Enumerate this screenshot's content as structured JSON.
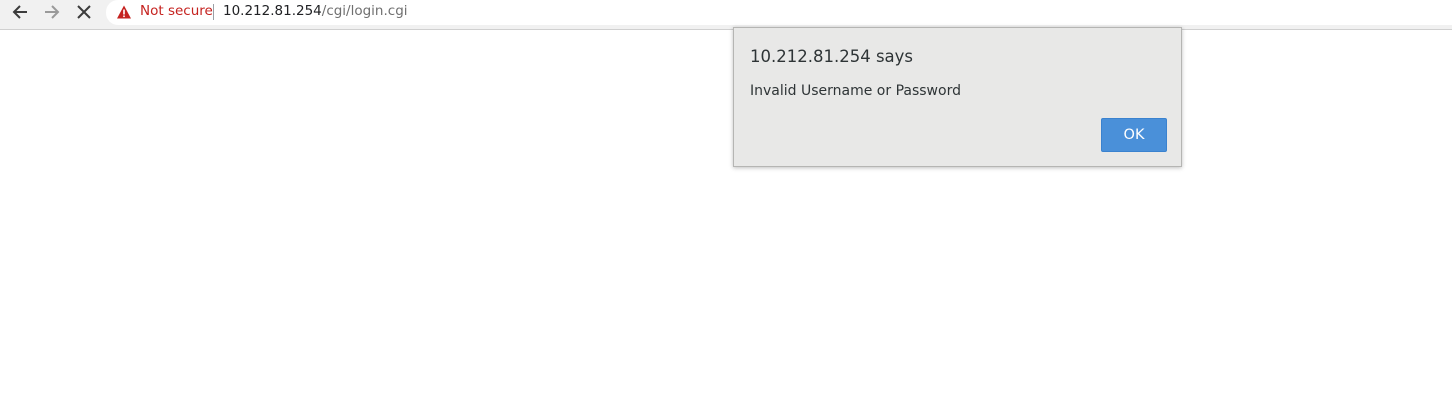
{
  "browser": {
    "nav": {
      "back_icon": "arrow-left-icon",
      "forward_icon": "arrow-right-icon",
      "stop_icon": "close-icon"
    },
    "omnibox": {
      "security_icon": "warning-triangle-icon",
      "security_label": "Not secure",
      "security_color": "#c5221f",
      "url_host": "10.212.81.254",
      "url_path": "/cgi/login.cgi"
    }
  },
  "dialog": {
    "title": "10.212.81.254 says",
    "message": "Invalid Username or Password",
    "ok_label": "OK",
    "button_color": "#4a90d9"
  }
}
